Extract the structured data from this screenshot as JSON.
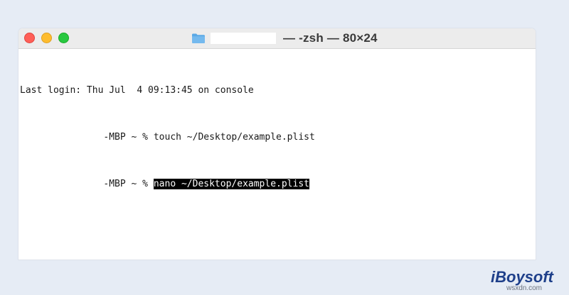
{
  "window": {
    "title": "— -zsh — 80×24",
    "folder_icon": "folder-icon"
  },
  "terminal": {
    "lines": [
      {
        "text": "Last login: Thu Jul  4 09:13:45 on console"
      },
      {
        "prompt": "               -MBP ~ % ",
        "command": "touch ~/Desktop/example.plist"
      },
      {
        "prompt": "               -MBP ~ % ",
        "command": "nano ~/Desktop/example.plist"
      }
    ]
  },
  "brand": {
    "logo_text": "iBoysoft"
  },
  "watermark": "wsxdn.com",
  "colors": {
    "close": "#ff5f57",
    "minimize": "#febc2e",
    "zoom": "#28c840",
    "folder": "#5aa9e6",
    "brand": "#1e3f8a",
    "selection_bg": "#000000"
  }
}
